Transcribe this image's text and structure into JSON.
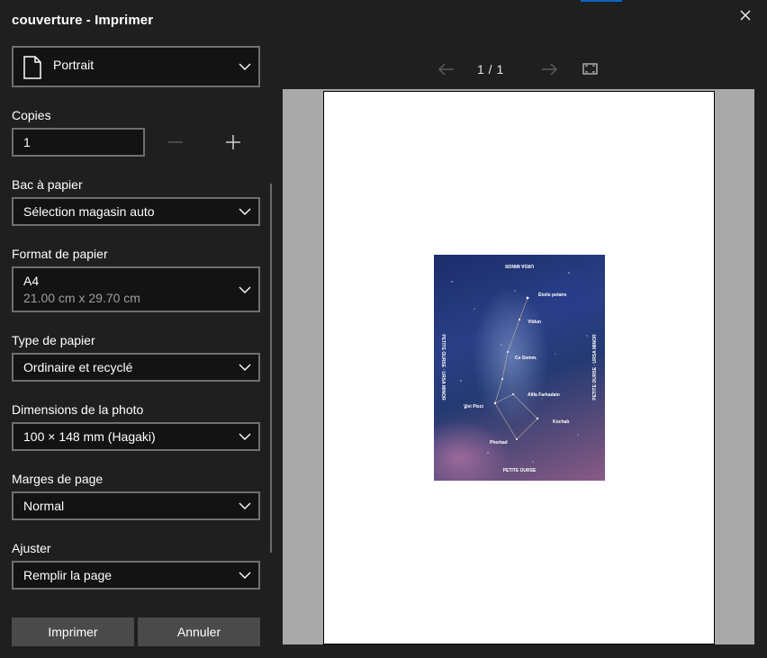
{
  "window": {
    "title": "couverture - Imprimer",
    "close_icon": "close-icon"
  },
  "orientation": {
    "value": "Portrait",
    "icon": "page-portrait-icon"
  },
  "copies": {
    "label": "Copies",
    "value": "1",
    "decrement_icon": "minus-icon",
    "increment_icon": "plus-icon"
  },
  "paper_tray": {
    "label": "Bac à papier",
    "value": "Sélection magasin auto"
  },
  "paper_size": {
    "label": "Format de papier",
    "value": "A4",
    "dimensions": "21.00 cm x 29.70 cm"
  },
  "paper_type": {
    "label": "Type de papier",
    "value": "Ordinaire et recyclé"
  },
  "photo_size": {
    "label": "Dimensions de la photo",
    "value": "100 × 148 mm (Hagaki)"
  },
  "margins": {
    "label": "Marges de page",
    "value": "Normal"
  },
  "fit": {
    "label": "Ajuster",
    "value": "Remplir la page"
  },
  "actions": {
    "print": "Imprimer",
    "cancel": "Annuler"
  },
  "preview": {
    "page_counter": "1 / 1",
    "prev_icon": "arrow-left-icon",
    "next_icon": "arrow-right-icon",
    "fit_icon": "fit-to-window-icon",
    "photo_labels": {
      "top": "URSA MINOR",
      "polaris": "Étoile polaire",
      "yildun": "Yildun",
      "epsilon": "Ce Somm.",
      "kochab": "Kochab",
      "pherkad": "Pherkad",
      "alifa": "Alifa Farkadain",
      "left_star": "Vivi Pisci",
      "bottom": "PETITE OURSE",
      "right_side": "PETITE OURSE · URSA MINOR",
      "left_side": "PETITE OURSE · URSA MINOR"
    }
  },
  "colors": {
    "background": "#1f1f1f",
    "field": "#131313",
    "field_border": "#6f6f6f",
    "button": "#4a4a4a",
    "accent": "#0a64c8",
    "preview_bg": "#a9a9a9"
  }
}
